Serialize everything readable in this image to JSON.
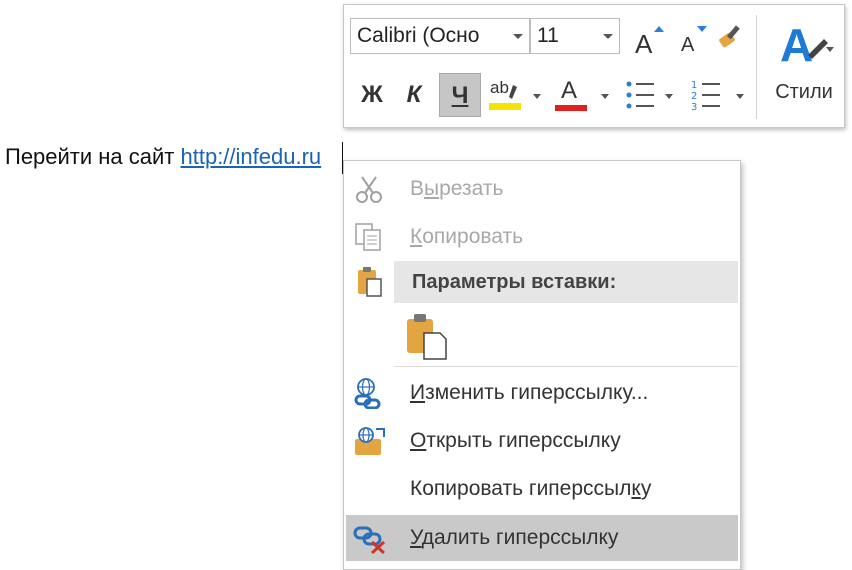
{
  "document": {
    "text_prefix": "Перейти на сайт ",
    "link_text": "http://infedu.ru"
  },
  "toolbar": {
    "font_name": "Calibri (Осно",
    "font_size": "11",
    "grow_font_label": "A",
    "shrink_font_label": "A",
    "bold_label": "Ж",
    "italic_label": "К",
    "underline_label": "Ч",
    "highlight_label": "ab",
    "font_color_label": "A",
    "styles_label": "Стили",
    "colors": {
      "highlight": "#f5e400",
      "font_color": "#e02020",
      "styles_icon": "#1e7bd4",
      "underline_active_bg": "#c6c6c6"
    },
    "icons": [
      "format-painter-icon",
      "bullets-icon",
      "numbering-icon",
      "styles-icon"
    ]
  },
  "context_menu": {
    "cut": {
      "prefix": "В",
      "underlined": "ы",
      "suffix": "резать"
    },
    "copy": {
      "prefix": "",
      "underlined": "К",
      "suffix": "опировать"
    },
    "paste_options_header": "Параметры вставки:",
    "edit_link": {
      "prefix": "",
      "underlined": "И",
      "suffix": "зменить гиперссылку..."
    },
    "open_link": {
      "prefix": "",
      "underlined": "О",
      "suffix": "ткрыть гиперссылку"
    },
    "copy_link": {
      "prefix": "Копировать гиперссыл",
      "underlined": "к",
      "suffix": "у"
    },
    "remove_link": {
      "prefix": "",
      "underlined": "У",
      "suffix": "далить гиперссылку"
    },
    "highlight_bg": "#c9c9c9"
  }
}
